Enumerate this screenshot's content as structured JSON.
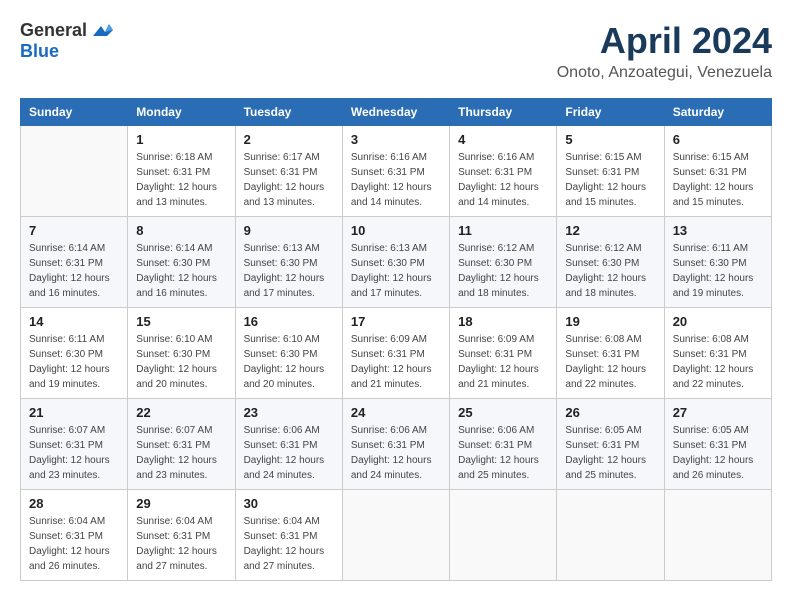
{
  "header": {
    "logo_general": "General",
    "logo_blue": "Blue",
    "month_year": "April 2024",
    "location": "Onoto, Anzoategui, Venezuela"
  },
  "weekdays": [
    "Sunday",
    "Monday",
    "Tuesday",
    "Wednesday",
    "Thursday",
    "Friday",
    "Saturday"
  ],
  "weeks": [
    [
      {
        "day": "",
        "sunrise": "",
        "sunset": "",
        "daylight": ""
      },
      {
        "day": "1",
        "sunrise": "Sunrise: 6:18 AM",
        "sunset": "Sunset: 6:31 PM",
        "daylight": "Daylight: 12 hours and 13 minutes."
      },
      {
        "day": "2",
        "sunrise": "Sunrise: 6:17 AM",
        "sunset": "Sunset: 6:31 PM",
        "daylight": "Daylight: 12 hours and 13 minutes."
      },
      {
        "day": "3",
        "sunrise": "Sunrise: 6:16 AM",
        "sunset": "Sunset: 6:31 PM",
        "daylight": "Daylight: 12 hours and 14 minutes."
      },
      {
        "day": "4",
        "sunrise": "Sunrise: 6:16 AM",
        "sunset": "Sunset: 6:31 PM",
        "daylight": "Daylight: 12 hours and 14 minutes."
      },
      {
        "day": "5",
        "sunrise": "Sunrise: 6:15 AM",
        "sunset": "Sunset: 6:31 PM",
        "daylight": "Daylight: 12 hours and 15 minutes."
      },
      {
        "day": "6",
        "sunrise": "Sunrise: 6:15 AM",
        "sunset": "Sunset: 6:31 PM",
        "daylight": "Daylight: 12 hours and 15 minutes."
      }
    ],
    [
      {
        "day": "7",
        "sunrise": "Sunrise: 6:14 AM",
        "sunset": "Sunset: 6:31 PM",
        "daylight": "Daylight: 12 hours and 16 minutes."
      },
      {
        "day": "8",
        "sunrise": "Sunrise: 6:14 AM",
        "sunset": "Sunset: 6:30 PM",
        "daylight": "Daylight: 12 hours and 16 minutes."
      },
      {
        "day": "9",
        "sunrise": "Sunrise: 6:13 AM",
        "sunset": "Sunset: 6:30 PM",
        "daylight": "Daylight: 12 hours and 17 minutes."
      },
      {
        "day": "10",
        "sunrise": "Sunrise: 6:13 AM",
        "sunset": "Sunset: 6:30 PM",
        "daylight": "Daylight: 12 hours and 17 minutes."
      },
      {
        "day": "11",
        "sunrise": "Sunrise: 6:12 AM",
        "sunset": "Sunset: 6:30 PM",
        "daylight": "Daylight: 12 hours and 18 minutes."
      },
      {
        "day": "12",
        "sunrise": "Sunrise: 6:12 AM",
        "sunset": "Sunset: 6:30 PM",
        "daylight": "Daylight: 12 hours and 18 minutes."
      },
      {
        "day": "13",
        "sunrise": "Sunrise: 6:11 AM",
        "sunset": "Sunset: 6:30 PM",
        "daylight": "Daylight: 12 hours and 19 minutes."
      }
    ],
    [
      {
        "day": "14",
        "sunrise": "Sunrise: 6:11 AM",
        "sunset": "Sunset: 6:30 PM",
        "daylight": "Daylight: 12 hours and 19 minutes."
      },
      {
        "day": "15",
        "sunrise": "Sunrise: 6:10 AM",
        "sunset": "Sunset: 6:30 PM",
        "daylight": "Daylight: 12 hours and 20 minutes."
      },
      {
        "day": "16",
        "sunrise": "Sunrise: 6:10 AM",
        "sunset": "Sunset: 6:30 PM",
        "daylight": "Daylight: 12 hours and 20 minutes."
      },
      {
        "day": "17",
        "sunrise": "Sunrise: 6:09 AM",
        "sunset": "Sunset: 6:31 PM",
        "daylight": "Daylight: 12 hours and 21 minutes."
      },
      {
        "day": "18",
        "sunrise": "Sunrise: 6:09 AM",
        "sunset": "Sunset: 6:31 PM",
        "daylight": "Daylight: 12 hours and 21 minutes."
      },
      {
        "day": "19",
        "sunrise": "Sunrise: 6:08 AM",
        "sunset": "Sunset: 6:31 PM",
        "daylight": "Daylight: 12 hours and 22 minutes."
      },
      {
        "day": "20",
        "sunrise": "Sunrise: 6:08 AM",
        "sunset": "Sunset: 6:31 PM",
        "daylight": "Daylight: 12 hours and 22 minutes."
      }
    ],
    [
      {
        "day": "21",
        "sunrise": "Sunrise: 6:07 AM",
        "sunset": "Sunset: 6:31 PM",
        "daylight": "Daylight: 12 hours and 23 minutes."
      },
      {
        "day": "22",
        "sunrise": "Sunrise: 6:07 AM",
        "sunset": "Sunset: 6:31 PM",
        "daylight": "Daylight: 12 hours and 23 minutes."
      },
      {
        "day": "23",
        "sunrise": "Sunrise: 6:06 AM",
        "sunset": "Sunset: 6:31 PM",
        "daylight": "Daylight: 12 hours and 24 minutes."
      },
      {
        "day": "24",
        "sunrise": "Sunrise: 6:06 AM",
        "sunset": "Sunset: 6:31 PM",
        "daylight": "Daylight: 12 hours and 24 minutes."
      },
      {
        "day": "25",
        "sunrise": "Sunrise: 6:06 AM",
        "sunset": "Sunset: 6:31 PM",
        "daylight": "Daylight: 12 hours and 25 minutes."
      },
      {
        "day": "26",
        "sunrise": "Sunrise: 6:05 AM",
        "sunset": "Sunset: 6:31 PM",
        "daylight": "Daylight: 12 hours and 25 minutes."
      },
      {
        "day": "27",
        "sunrise": "Sunrise: 6:05 AM",
        "sunset": "Sunset: 6:31 PM",
        "daylight": "Daylight: 12 hours and 26 minutes."
      }
    ],
    [
      {
        "day": "28",
        "sunrise": "Sunrise: 6:04 AM",
        "sunset": "Sunset: 6:31 PM",
        "daylight": "Daylight: 12 hours and 26 minutes."
      },
      {
        "day": "29",
        "sunrise": "Sunrise: 6:04 AM",
        "sunset": "Sunset: 6:31 PM",
        "daylight": "Daylight: 12 hours and 27 minutes."
      },
      {
        "day": "30",
        "sunrise": "Sunrise: 6:04 AM",
        "sunset": "Sunset: 6:31 PM",
        "daylight": "Daylight: 12 hours and 27 minutes."
      },
      {
        "day": "",
        "sunrise": "",
        "sunset": "",
        "daylight": ""
      },
      {
        "day": "",
        "sunrise": "",
        "sunset": "",
        "daylight": ""
      },
      {
        "day": "",
        "sunrise": "",
        "sunset": "",
        "daylight": ""
      },
      {
        "day": "",
        "sunrise": "",
        "sunset": "",
        "daylight": ""
      }
    ]
  ]
}
